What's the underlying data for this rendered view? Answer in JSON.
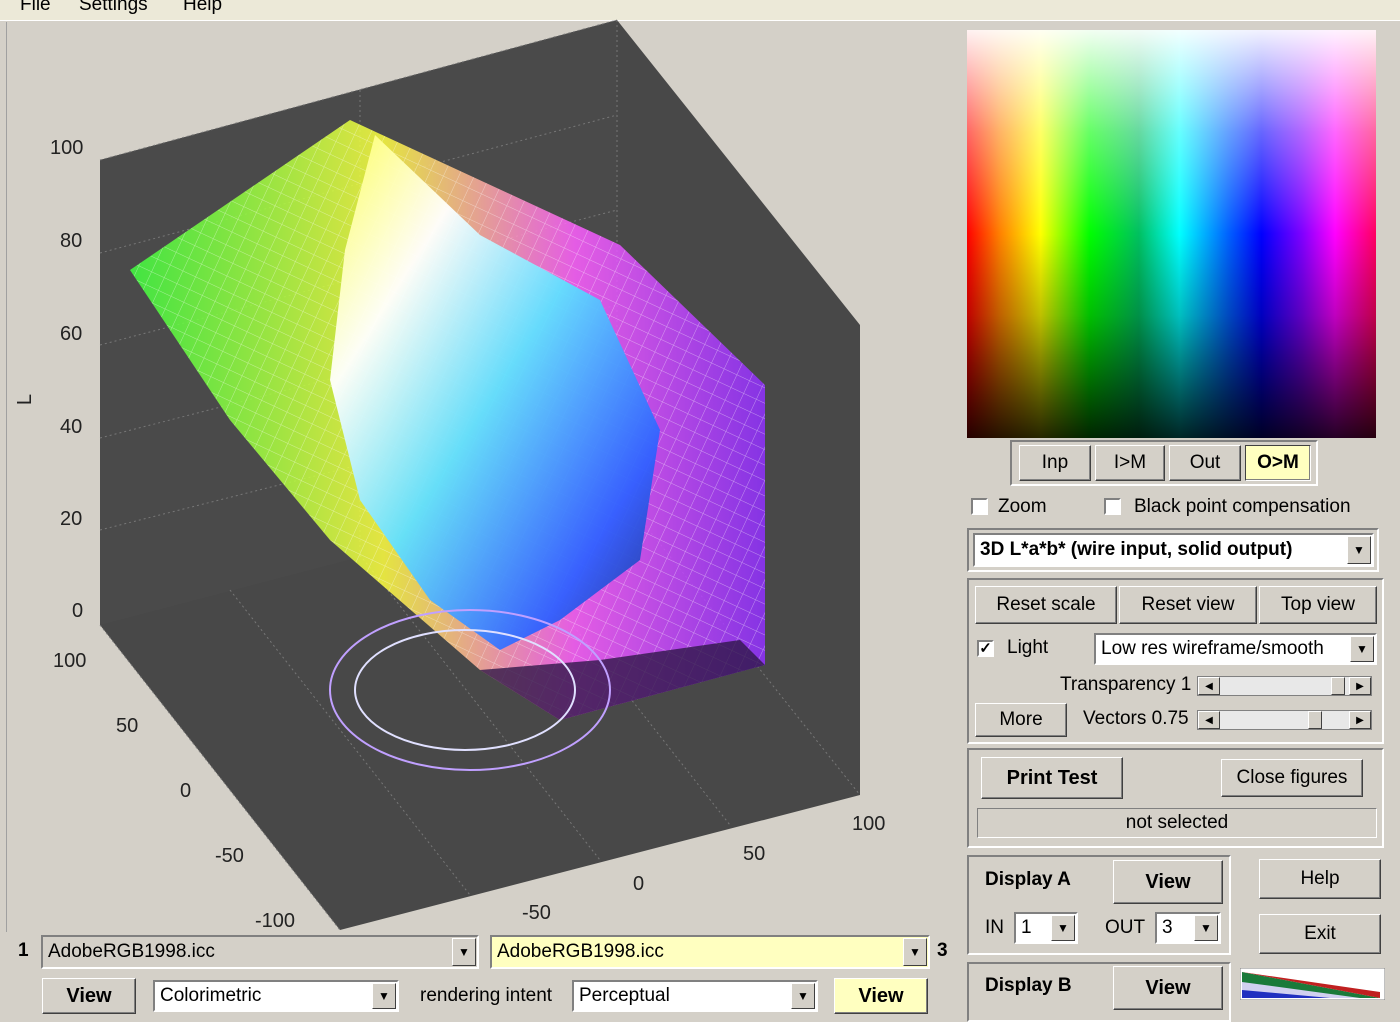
{
  "menu": {
    "file": "File",
    "settings": "Settings",
    "help": "Help"
  },
  "plot": {
    "ylabel": "L",
    "z_ticks": [
      "100",
      "80",
      "60",
      "40",
      "20",
      "0"
    ],
    "a_ticks": [
      "100",
      "50",
      "0",
      "-50",
      "-100"
    ],
    "b_ticks": [
      "100",
      "50",
      "0",
      "-50"
    ]
  },
  "preview_buttons": {
    "inp": "Inp",
    "im": "I>M",
    "out": "Out",
    "om": "O>M"
  },
  "options": {
    "zoom": "Zoom",
    "black_point": "Black point compensation"
  },
  "view_mode": {
    "selected": "3D L*a*b* (wire input, solid output)"
  },
  "view_controls": {
    "reset_scale": "Reset scale",
    "reset_view": "Reset view",
    "top_view": "Top view",
    "light_label": "Light",
    "light_checked": true,
    "render_mode": "Low res wireframe/smooth",
    "transparency_label": "Transparency 1",
    "transparency_value": 0.95,
    "more": "More",
    "vectors_label": "Vectors 0.75",
    "vectors_value": 0.75
  },
  "print": {
    "print_test": "Print Test",
    "close_figures": "Close figures",
    "status": "not selected"
  },
  "display_a": {
    "title": "Display A",
    "view": "View",
    "in_label": "IN",
    "in_value": "1",
    "out_label": "OUT",
    "out_value": "3"
  },
  "display_b": {
    "title": "Display B",
    "view": "View"
  },
  "side_buttons": {
    "help": "Help",
    "exit": "Exit"
  },
  "profiles": {
    "left_index": "1",
    "left_profile": "AdobeRGB1998.icc",
    "right_index": "3",
    "right_profile": "AdobeRGB1998.icc"
  },
  "bottom": {
    "view_left": "View",
    "intent_left": "Colorimetric",
    "rendering_intent_label": "rendering intent",
    "intent_right": "Perceptual",
    "view_right": "View"
  }
}
